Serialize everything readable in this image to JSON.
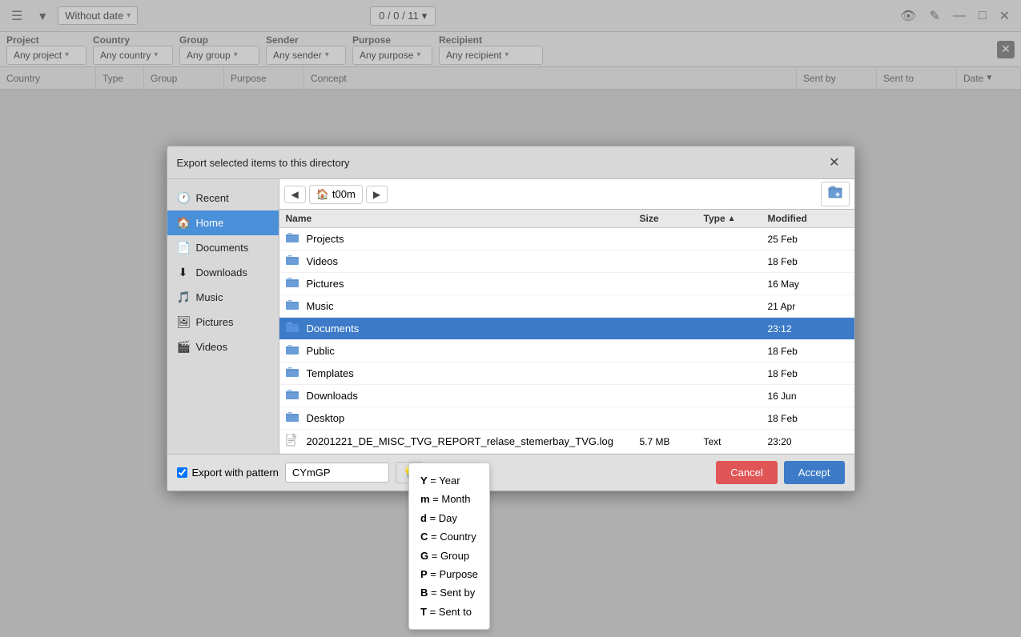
{
  "toolbar": {
    "menu_icon": "☰",
    "filter_icon": "▼",
    "filter_label": "Without date",
    "counter": "0 / 0 / 11",
    "counter_arrow": "▾",
    "eye_icon": "👁",
    "edit_icon": "✎",
    "minimize": "—",
    "maximize": "□",
    "close": "✕"
  },
  "filter_bar": {
    "project_label": "Project",
    "project_value": "Any project",
    "country_label": "Country",
    "country_value": "Any country",
    "group_label": "Group",
    "group_value": "Any group",
    "sender_label": "Sender",
    "sender_value": "Any sender",
    "purpose_label": "Purpose",
    "purpose_value": "Any purpose",
    "recipient_label": "Recipient",
    "recipient_value": "Any recipient"
  },
  "col_headers": {
    "country": "Country",
    "type": "Type",
    "group": "Group",
    "purpose": "Purpose",
    "concept": "Concept",
    "sent_by": "Sent by",
    "sent_to": "Sent to",
    "date": "Date"
  },
  "dialog": {
    "title": "Export selected items to this directory",
    "close": "✕",
    "sidebar": [
      {
        "id": "recent",
        "icon": "🕐",
        "label": "Recent"
      },
      {
        "id": "home",
        "icon": "🏠",
        "label": "Home",
        "active": true
      },
      {
        "id": "documents",
        "icon": "📄",
        "label": "Documents"
      },
      {
        "id": "downloads",
        "icon": "⬇",
        "label": "Downloads"
      },
      {
        "id": "music",
        "icon": "🎵",
        "label": "Music"
      },
      {
        "id": "pictures",
        "icon": "🖼",
        "label": "Pictures"
      },
      {
        "id": "videos",
        "icon": "🎬",
        "label": "Videos"
      }
    ],
    "nav": {
      "back": "◀",
      "location": "t00m",
      "forward": "▶",
      "new_folder": "📁+"
    },
    "file_list_headers": {
      "name": "Name",
      "size": "Size",
      "type": "Type",
      "sort_arrow": "▲",
      "modified": "Modified"
    },
    "files": [
      {
        "icon": "📁",
        "name": "Projects",
        "size": "",
        "type": "",
        "modified": "25 Feb",
        "selected": false
      },
      {
        "icon": "📁",
        "name": "Videos",
        "size": "",
        "type": "",
        "modified": "18 Feb",
        "selected": false
      },
      {
        "icon": "📁",
        "name": "Pictures",
        "size": "",
        "type": "",
        "modified": "16 May",
        "selected": false
      },
      {
        "icon": "📁",
        "name": "Music",
        "size": "",
        "type": "",
        "modified": "21 Apr",
        "selected": false
      },
      {
        "icon": "📁",
        "name": "Documents",
        "size": "",
        "type": "",
        "modified": "23:12",
        "selected": true
      },
      {
        "icon": "📁",
        "name": "Public",
        "size": "",
        "type": "",
        "modified": "18 Feb",
        "selected": false
      },
      {
        "icon": "📁",
        "name": "Templates",
        "size": "",
        "type": "",
        "modified": "18 Feb",
        "selected": false
      },
      {
        "icon": "📁",
        "name": "Downloads",
        "size": "",
        "type": "",
        "modified": "16 Jun",
        "selected": false
      },
      {
        "icon": "📁",
        "name": "Desktop",
        "size": "",
        "type": "",
        "modified": "18 Feb",
        "selected": false
      },
      {
        "icon": "📄",
        "name": "20201221_DE_MISC_TVG_REPORT_relase_stemerbay_TVG.log",
        "size": "5.7 MB",
        "type": "Text",
        "modified": "23:20",
        "selected": false
      }
    ],
    "footer": {
      "checkbox_label": "Export with pattern",
      "pattern_value": "CYmGP",
      "pattern_icon": "💡",
      "cancel_label": "Cancel",
      "accept_label": "Accept"
    }
  },
  "tooltip": {
    "items": [
      {
        "key": "Y",
        "sep": " = ",
        "value": "Year"
      },
      {
        "key": "m",
        "sep": " = ",
        "value": "Month"
      },
      {
        "key": "d",
        "sep": " = ",
        "value": "Day"
      },
      {
        "key": "C",
        "sep": " = ",
        "value": "Country"
      },
      {
        "key": "G",
        "sep": " = ",
        "value": "Group"
      },
      {
        "key": "P",
        "sep": " = ",
        "value": "Purpose"
      },
      {
        "key": "B",
        "sep": " = ",
        "value": "Sent by"
      },
      {
        "key": "T",
        "sep": " = ",
        "value": "Sent to"
      }
    ]
  }
}
